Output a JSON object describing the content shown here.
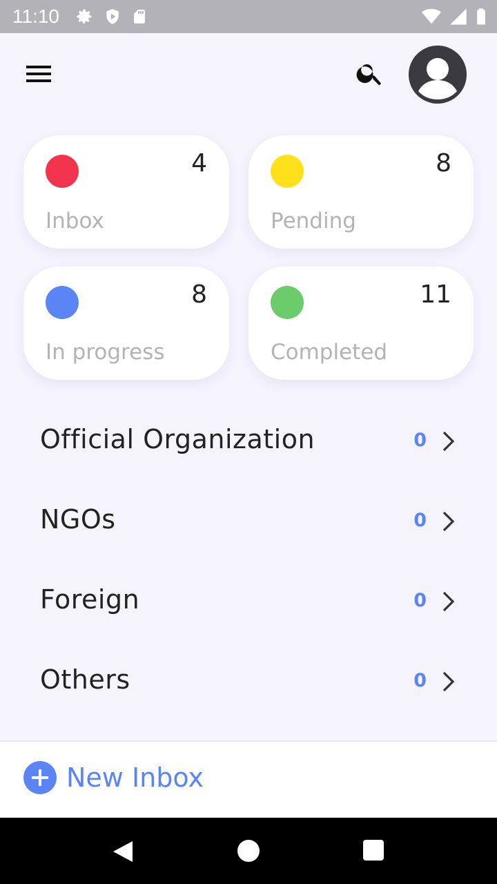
{
  "status_bar": {
    "time": "11:10",
    "left_icons": [
      "gear-icon",
      "shield-icon",
      "sd-card-icon"
    ],
    "right_icons": [
      "wifi-icon",
      "signal-icon",
      "battery-icon"
    ]
  },
  "app_bar": {
    "menu_icon": "hamburger-menu-icon",
    "search_icon": "search-icon",
    "avatar_icon": "account-circle-icon"
  },
  "cards": [
    {
      "label": "Inbox",
      "count": "4",
      "color": "#f2344f"
    },
    {
      "label": "Pending",
      "count": "8",
      "color": "#ffe01a"
    },
    {
      "label": "In progress",
      "count": "8",
      "color": "#5b85f6"
    },
    {
      "label": "Completed",
      "count": "11",
      "color": "#6ccb6a"
    }
  ],
  "categories": [
    {
      "label": "Official Organization",
      "count": "0"
    },
    {
      "label": "NGOs",
      "count": "0"
    },
    {
      "label": "Foreign",
      "count": "0"
    },
    {
      "label": "Others",
      "count": "0"
    }
  ],
  "bottom": {
    "new_inbox_label": "New Inbox",
    "accent_color": "#5b85f6"
  },
  "nav": {
    "back_icon": "back-triangle-icon",
    "home_icon": "home-circle-icon",
    "recents_icon": "recents-square-icon"
  }
}
